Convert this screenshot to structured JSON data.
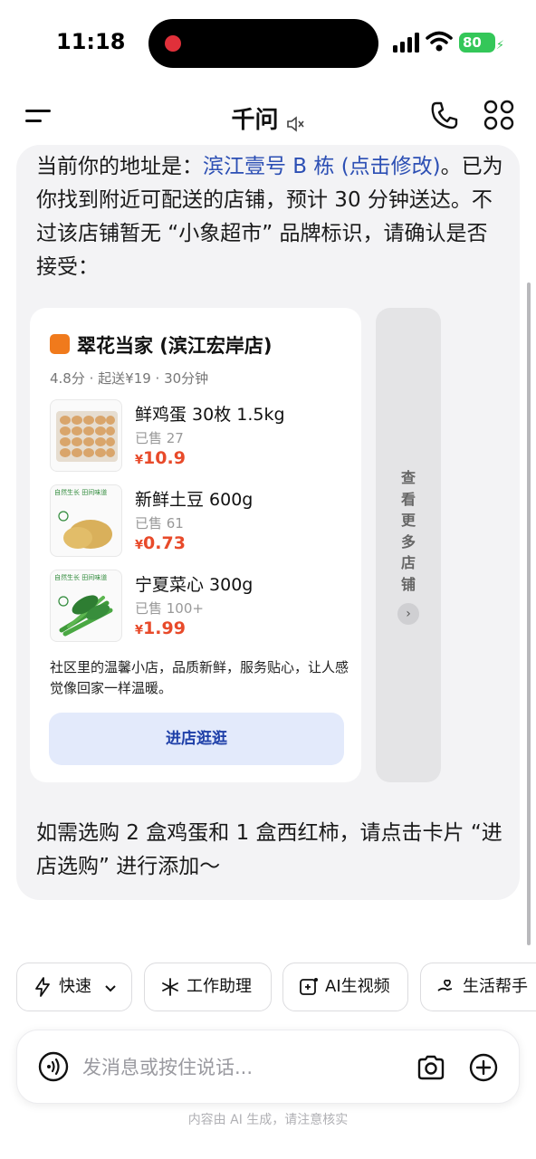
{
  "status": {
    "time": "11:18",
    "battery": "80"
  },
  "header": {
    "title": "千问"
  },
  "message": {
    "intro_prefix": "当前你的地址是：",
    "address_link": "滨江壹号 B 栋 (点击修改)",
    "intro_suffix": "。已为你找到附近可配送的店铺，预计 30 分钟送达。不过该店铺暂无 “小象超市” 品牌标识，请确认是否接受：",
    "followup": "如需选购 2 盒鸡蛋和 1 盒西红柿，请点击卡片 “进店选购” 进行添加～"
  },
  "store": {
    "name": "翠花当家 (滨江宏岸店)",
    "meta": "4.8分 · 起送¥19 · 30分钟",
    "currency": "¥",
    "products": [
      {
        "name": "鲜鸡蛋 30枚 1.5kg",
        "sold": "已售 27",
        "price": "10.9"
      },
      {
        "name": "新鲜土豆 600g",
        "sold": "已售 61",
        "price": "0.73"
      },
      {
        "name": "宁夏菜心 300g",
        "sold": "已售 100+",
        "price": "1.99"
      }
    ],
    "product_tag": "自然生长 田间味道",
    "description": "社区里的温馨小店，品质新鲜，服务贴心，让人感觉像回家一样温暖。",
    "enter_button": "进店逛逛",
    "more_stores": "查看更多店铺"
  },
  "chips": [
    {
      "label": "快速",
      "icon": "lightning-icon"
    },
    {
      "label": "工作助理",
      "icon": "sparkle-icon"
    },
    {
      "label": "AI生视频",
      "icon": "video-plus-icon"
    },
    {
      "label": "生活帮手",
      "icon": "hand-heart-icon"
    }
  ],
  "input": {
    "placeholder": "发消息或按住说话..."
  },
  "disclaimer": "内容由 AI 生成，请注意核实",
  "colors": {
    "link": "#2c4fb4",
    "price": "#e84a2a",
    "button_bg": "#e3eafb",
    "button_text": "#1e3fa8",
    "bubble_bg": "#f3f3f5"
  }
}
